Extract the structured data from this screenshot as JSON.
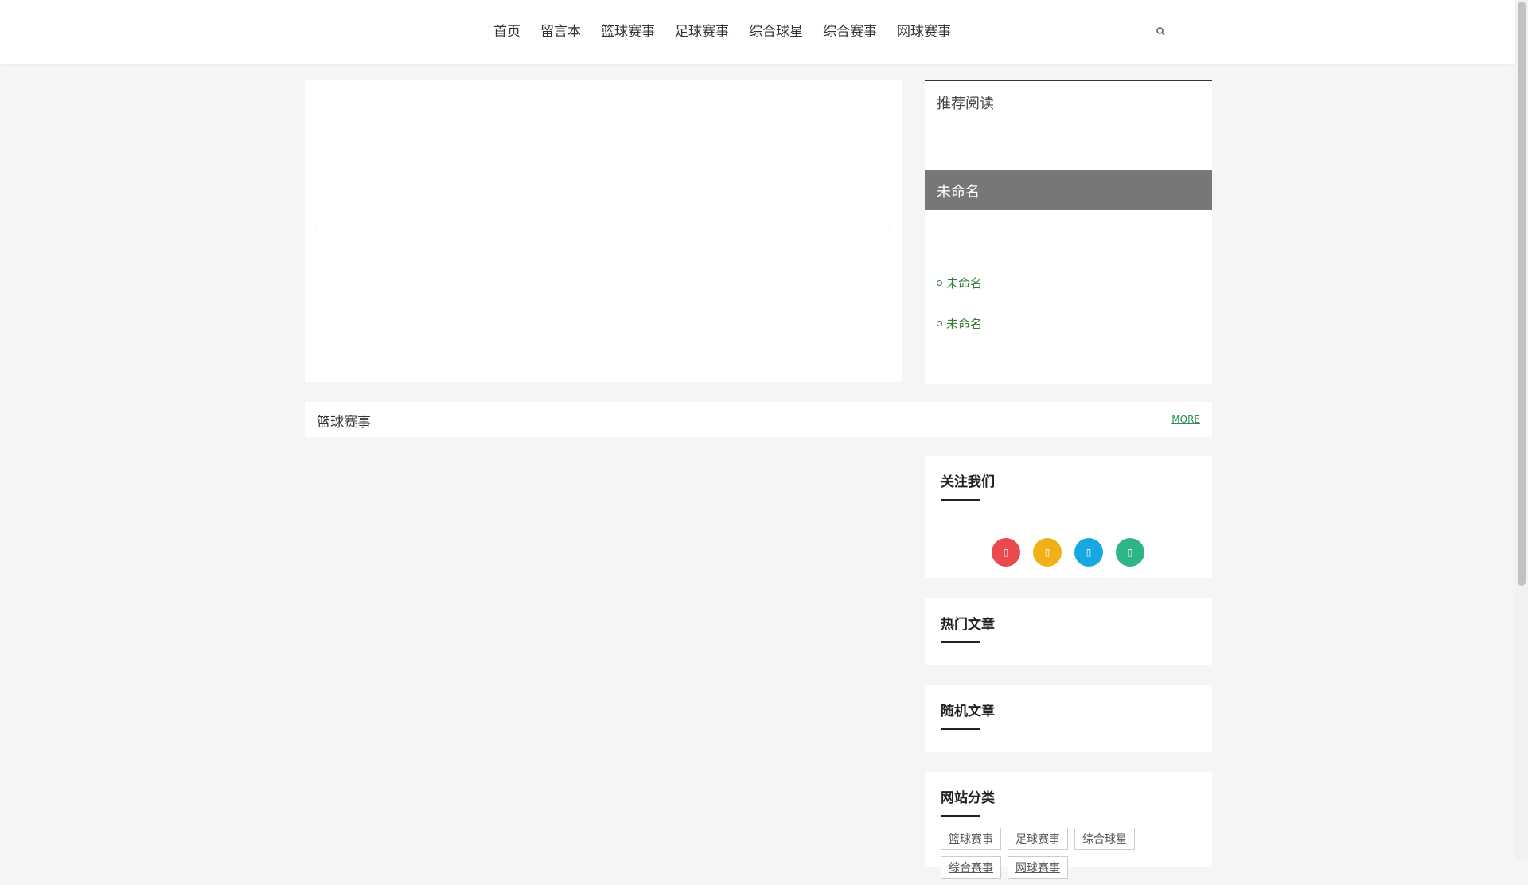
{
  "nav": {
    "items": [
      "首页",
      "留言本",
      "篮球赛事",
      "足球赛事",
      "综合球星",
      "综合赛事",
      "网球赛事"
    ]
  },
  "recommend": {
    "title": "推荐阅读",
    "band_title": "未命名",
    "links": [
      "未命名",
      "未命名"
    ]
  },
  "section": {
    "title": "篮球赛事",
    "more": "MORE"
  },
  "widgets": {
    "follow_title": "关注我们",
    "social_colors": [
      "#e84a4f",
      "#f0b017",
      "#17a8e3",
      "#2db588"
    ],
    "hot_title": "热门文章",
    "random_title": "随机文章",
    "categories_title": "网站分类",
    "categories": [
      "篮球赛事",
      "足球赛事",
      "综合球星",
      "综合赛事",
      "网球赛事"
    ]
  },
  "icons": {
    "search": "search-icon",
    "social": [
      "weibo-icon",
      "qq-icon",
      "twitter-icon",
      "wechat-icon"
    ]
  }
}
